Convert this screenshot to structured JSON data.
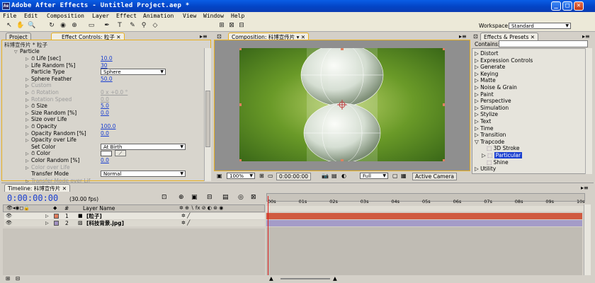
{
  "window": {
    "title": "Adobe After Effects - Untitled Project.aep *",
    "app_icon": "Ae"
  },
  "menu": [
    "File",
    "Edit",
    "Composition",
    "Layer",
    "Effect",
    "Animation",
    "View",
    "Window",
    "Help"
  ],
  "toolbar": {
    "workspace_label": "Workspace:",
    "workspace_value": "Standard"
  },
  "left_panel": {
    "tabs": [
      "Project",
      "Effect Controls: 粒子"
    ],
    "breadcrumb": "科博宣传片 * 粒子",
    "group": "Particle",
    "rows": [
      {
        "label": "Life [sec]",
        "value": "10.0",
        "stopwatch": true,
        "indent": 2,
        "tri": true
      },
      {
        "label": "Life Random [%]",
        "value": "30",
        "indent": 2,
        "tri": true
      },
      {
        "label": "Particle Type",
        "dropdown": "Sphere",
        "indent": 2
      },
      {
        "label": "Sphere Feather",
        "value": "50.0",
        "indent": 2,
        "tri": true
      },
      {
        "label": "Custom",
        "disabled": true,
        "indent": 2,
        "tri": true
      },
      {
        "label": "Rotation",
        "value": "0 x +0.0 °",
        "disabled": true,
        "stopwatch": true,
        "indent": 2,
        "tri": true
      },
      {
        "label": "Rotation Speed",
        "value": "0.0",
        "disabled": true,
        "indent": 2,
        "tri": true
      },
      {
        "label": "Size",
        "value": "5.0",
        "stopwatch": true,
        "indent": 2,
        "tri": true
      },
      {
        "label": "Size Random [%]",
        "value": "0.0",
        "indent": 2,
        "tri": true
      },
      {
        "label": "Size over Life",
        "indent": 2,
        "tri": true
      },
      {
        "label": "Opacity",
        "value": "100.0",
        "stopwatch": true,
        "indent": 2,
        "tri": true
      },
      {
        "label": "Opacity Random [%]",
        "value": "0.0",
        "indent": 2,
        "tri": true
      },
      {
        "label": "Opacity over Life",
        "indent": 2,
        "tri": true
      },
      {
        "label": "Set Color",
        "dropdown": "At Birth",
        "indent": 2
      },
      {
        "label": "Color",
        "swatch": true,
        "stopwatch": true,
        "indent": 2,
        "tri": true
      },
      {
        "label": "Color Random [%]",
        "value": "0.0",
        "indent": 2,
        "tri": true
      },
      {
        "label": "Color over Life",
        "disabled": true,
        "indent": 2,
        "tri": true
      },
      {
        "label": "Transfer Mode",
        "dropdown": "Normal",
        "indent": 2
      },
      {
        "label": "Transfer Mode over Lif",
        "disabled": true,
        "indent": 2,
        "tri": true
      }
    ]
  },
  "comp_panel": {
    "tab": "Composition: 科博宣传片",
    "zoom": "100%",
    "timecode": "0:00:00:00",
    "quality": "Full",
    "camera": "Active Camera"
  },
  "effects_panel": {
    "tab": "Effects & Presets",
    "contains_label": "Contains:",
    "items": [
      {
        "label": "Distort",
        "open": false
      },
      {
        "label": "Expression Controls",
        "open": false
      },
      {
        "label": "Generate",
        "open": false
      },
      {
        "label": "Keying",
        "open": false
      },
      {
        "label": "Matte",
        "open": false
      },
      {
        "label": "Noise & Grain",
        "open": false
      },
      {
        "label": "Paint",
        "open": false
      },
      {
        "label": "Perspective",
        "open": false
      },
      {
        "label": "Simulation",
        "open": false
      },
      {
        "label": "Stylize",
        "open": false
      },
      {
        "label": "Text",
        "open": false
      },
      {
        "label": "Time",
        "open": false
      },
      {
        "label": "Transition",
        "open": false
      },
      {
        "label": "Trapcode",
        "open": true
      },
      {
        "label": "3D Stroke",
        "child": true
      },
      {
        "label": "Particular",
        "child": true,
        "selected": true,
        "tri": true
      },
      {
        "label": "Shine",
        "child": true
      },
      {
        "label": "Utility",
        "open": false
      }
    ]
  },
  "timeline": {
    "tab": "Timeline: 科博宣传片",
    "timecode": "0:00:00:00",
    "fps": "(30.00 fps)",
    "header_num": "#",
    "header_name": "Layer Name",
    "ruler": [
      "00s",
      "01s",
      "02s",
      "03s",
      "04s",
      "05s",
      "06s",
      "07s",
      "08s",
      "09s",
      "10s"
    ],
    "layers": [
      {
        "num": "1",
        "name": "[粒子]",
        "color": "#e07a5a",
        "bar": "#d05a40"
      },
      {
        "num": "2",
        "name": "[科技背景.jpg]",
        "color": "#a090c0",
        "bar": "#a49cc8"
      }
    ]
  },
  "colors": {
    "accent": "#1a3fd0",
    "title": "#0a5ee6",
    "selection": "#1a3fd0",
    "timeline_bg": "#c8c4bc",
    "playhead": "#e02020"
  }
}
